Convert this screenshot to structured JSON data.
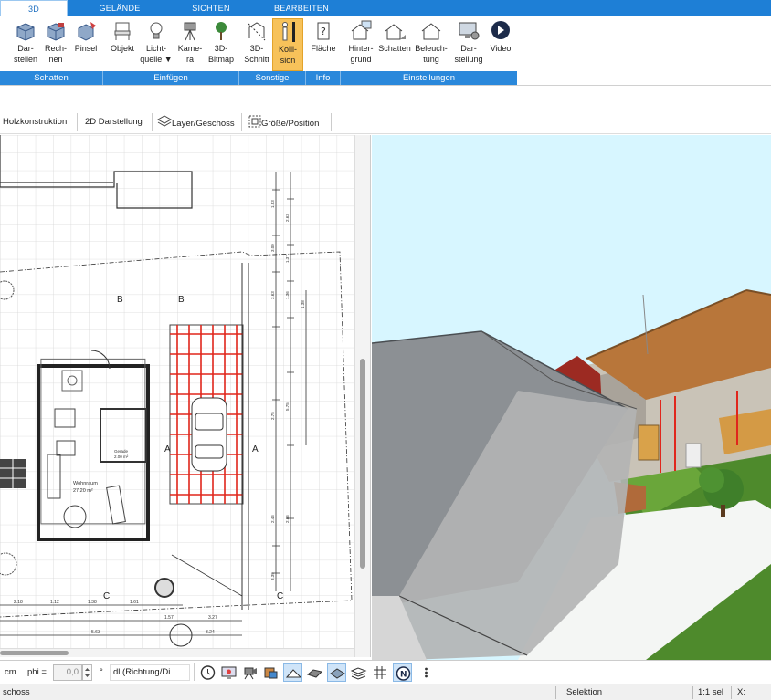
{
  "ribbon": {
    "tabs": [
      "3D",
      "GELÄNDE",
      "SICHTEN",
      "BEARBEITEN"
    ],
    "active_tab": "3D",
    "buttons": {
      "darstellen": [
        "Dar-",
        "stellen"
      ],
      "rechnen": [
        "Rech-",
        "nen"
      ],
      "pinsel": [
        "Pinsel"
      ],
      "objekt": [
        "Objekt"
      ],
      "lichtquelle": [
        "Licht-",
        "quelle"
      ],
      "kamera": [
        "Kame-",
        "ra"
      ],
      "bitmap3d": [
        "3D-",
        "Bitmap"
      ],
      "schnitt3d": [
        "3D-",
        "Schnitt"
      ],
      "kollision": [
        "Kolli-",
        "sion"
      ],
      "flaeche": [
        "Fläche"
      ],
      "hintergrund": [
        "Hinter-",
        "grund"
      ],
      "schatten": [
        "Schatten"
      ],
      "beleuchtung": [
        "Beleuch-",
        "tung"
      ],
      "darstellung": [
        "Dar-",
        "stellung"
      ],
      "video": [
        "Video"
      ]
    },
    "groups": [
      "Schatten",
      "Einfügen",
      "Sonstige",
      "Info",
      "Einstellungen"
    ]
  },
  "toolbar2": {
    "holzkonstruktion": "Holzkonstruktion",
    "darstellung2d": "2D Darstellung",
    "layer": "Layer/Geschoss",
    "groesse": "Größe/Position"
  },
  "plan": {
    "room_label": "Wohnraum",
    "room_area": "27.20 m²",
    "room_small_label": "Gerade",
    "room_small_area": "2.00 m²",
    "section_marks": [
      "A",
      "A",
      "B",
      "B",
      "C",
      "C"
    ],
    "dims_bottom": [
      "2.18",
      "1.12",
      "1.38",
      "1.61",
      "1.57",
      "3.27",
      "5.63",
      "3.24"
    ],
    "dims_right": [
      "1.33",
      "3.09",
      "2.63",
      "1.37",
      "3.63",
      "1.36",
      "1.38",
      "2.75",
      "5.75",
      "2.46",
      "3.39",
      "2.86"
    ]
  },
  "bottombar": {
    "unit": "cm",
    "phi_label": "phi =",
    "phi_value": "0,0",
    "degree": "°",
    "direction": "dl (Richtung/Di"
  },
  "status": {
    "left": "schoss",
    "mode": "Selektion",
    "selection": "1:1 sel",
    "x_label": "X:"
  },
  "colors": {
    "ribbon_blue": "#1e7fd6",
    "active_orange": "#f7c25a",
    "sky": "#d7f6ff",
    "grass": "#4e8a2c",
    "roof_brown": "#b8763a",
    "timber_red": "#e0261c"
  }
}
